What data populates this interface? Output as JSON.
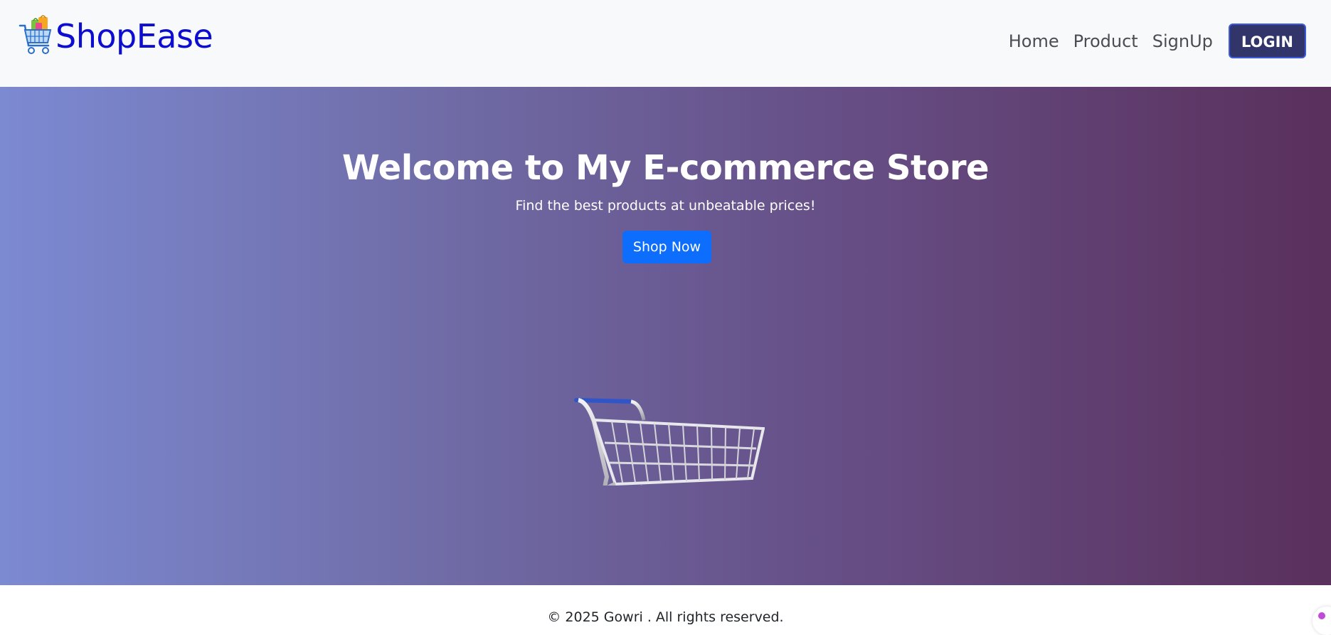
{
  "navbar": {
    "brand": {
      "text": "ShopEase",
      "logo_icon": "shopping-cart-with-bags-icon",
      "text_color": "#0d0dd1"
    },
    "links": [
      {
        "label": "Home"
      },
      {
        "label": "Product"
      },
      {
        "label": "SignUp"
      }
    ],
    "login_label": "LOGIN",
    "login_color": "#32356a"
  },
  "hero": {
    "title": "Welcome to My E-commerce Store",
    "subtitle": "Find the best products at unbeatable prices!",
    "cta_label": "Shop Now",
    "cta_color": "#0d6efd",
    "image_icon": "shopping-cart-icon",
    "gradient_colors": [
      "#7c8ad2",
      "#5a305c"
    ]
  },
  "footer": {
    "text": "© 2025 Gowri . All rights reserved."
  }
}
